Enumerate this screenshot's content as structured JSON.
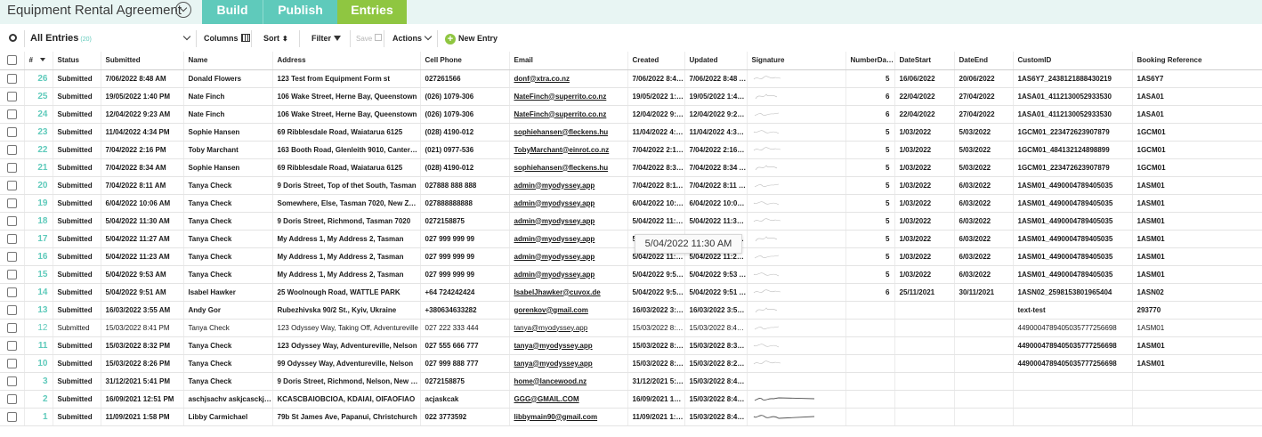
{
  "header": {
    "form_title": "Equipment Rental Agreement",
    "tabs": [
      {
        "label": "Build"
      },
      {
        "label": "Publish"
      },
      {
        "label": "Entries"
      }
    ]
  },
  "toolbar": {
    "view_label": "All Entries",
    "view_count": "(20)",
    "columns_label": "Columns",
    "sort_label": "Sort",
    "filter_label": "Filter",
    "save_label": "Save",
    "actions_label": "Actions",
    "new_entry_label": "New Entry"
  },
  "table": {
    "columns": [
      "#",
      "Status",
      "Submitted",
      "Name",
      "Address",
      "Cell Phone",
      "Email",
      "Created",
      "Updated",
      "Signature",
      "NumberDays",
      "DateStart",
      "DateEnd",
      "CustomID",
      "Booking Reference"
    ],
    "rows": [
      {
        "num": "26",
        "status": "Submitted",
        "submitted": "7/06/2022 8:48 AM",
        "name": "Donald Flowers",
        "address": "123 Test from Equipment Form st",
        "phone": "027261566",
        "email": "donf@xtra.co.nz",
        "created": "7/06/2022 8:48 AM",
        "updated": "7/06/2022 8:48 AM",
        "days": "5",
        "start": "16/06/2022",
        "end": "20/06/2022",
        "custom": "1AS6Y7_2438121888430219",
        "booking": "1AS6Y7",
        "read": true
      },
      {
        "num": "25",
        "status": "Submitted",
        "submitted": "19/05/2022 1:40 PM",
        "name": "Nate Finch",
        "address": "106 Wake Street, Herne Bay, Queenstown",
        "phone": "(026) 1079-306",
        "email": "NateFinch@superrito.co.nz",
        "created": "19/05/2022 1:40 PM",
        "updated": "19/05/2022 1:40 PM",
        "days": "6",
        "start": "22/04/2022",
        "end": "27/04/2022",
        "custom": "1ASA01_4112130052933530",
        "booking": "1ASA01",
        "read": true
      },
      {
        "num": "24",
        "status": "Submitted",
        "submitted": "12/04/2022 9:23 AM",
        "name": "Nate Finch",
        "address": "106 Wake Street, Herne Bay, Queenstown",
        "phone": "(026) 1079-306",
        "email": "NateFinch@superrito.co.nz",
        "created": "12/04/2022 9:23 AM",
        "updated": "12/04/2022 9:23 AM",
        "days": "6",
        "start": "22/04/2022",
        "end": "27/04/2022",
        "custom": "1ASA01_4112130052933530",
        "booking": "1ASA01",
        "read": true
      },
      {
        "num": "23",
        "status": "Submitted",
        "submitted": "11/04/2022 4:34 PM",
        "name": "Sophie Hansen",
        "address": "69 Ribblesdale Road, Waiatarua 6125",
        "phone": "(028) 4190-012",
        "email": "sophiehansen@fleckens.hu",
        "created": "11/04/2022 4:34 PM",
        "updated": "11/04/2022 4:34 PM",
        "days": "5",
        "start": "1/03/2022",
        "end": "5/03/2022",
        "custom": "1GCM01_223472623907879",
        "booking": "1GCM01",
        "read": true
      },
      {
        "num": "22",
        "status": "Submitted",
        "submitted": "7/04/2022 2:16 PM",
        "name": "Toby Marchant",
        "address": "163 Booth Road, Glenleith 9010, Canterbury",
        "phone": "(021) 0977-536",
        "email": "TobyMarchant@einrot.co.nz",
        "created": "7/04/2022 2:16 PM",
        "updated": "7/04/2022 2:16 PM",
        "days": "5",
        "start": "1/03/2022",
        "end": "5/03/2022",
        "custom": "1GCM01_484132124898899",
        "booking": "1GCM01",
        "read": true
      },
      {
        "num": "21",
        "status": "Submitted",
        "submitted": "7/04/2022 8:34 AM",
        "name": "Sophie Hansen",
        "address": "69 Ribblesdale Road, Waiatarua 6125",
        "phone": "(028) 4190-012",
        "email": "sophiehansen@fleckens.hu",
        "created": "7/04/2022 8:34 AM",
        "updated": "7/04/2022 8:34 AM",
        "days": "5",
        "start": "1/03/2022",
        "end": "5/03/2022",
        "custom": "1GCM01_223472623907879",
        "booking": "1GCM01",
        "read": true
      },
      {
        "num": "20",
        "status": "Submitted",
        "submitted": "7/04/2022 8:11 AM",
        "name": "Tanya Check",
        "address": "9 Doris Street, Top of thet South, Tasman",
        "phone": "027888 888 888",
        "email": "admin@myodyssey.app",
        "created": "7/04/2022 8:11 AM",
        "updated": "7/04/2022 8:11 AM",
        "days": "5",
        "start": "1/03/2022",
        "end": "6/03/2022",
        "custom": "1ASM01_4490004789405035",
        "booking": "1ASM01",
        "read": true
      },
      {
        "num": "19",
        "status": "Submitted",
        "submitted": "6/04/2022 10:06 AM",
        "name": "Tanya Check",
        "address": "Somewhere, Else, Tasman 7020, New Zealand",
        "phone": "027888888888",
        "email": "admin@myodyssey.app",
        "created": "6/04/2022 10:06 AM",
        "updated": "6/04/2022 10:06 AM",
        "days": "5",
        "start": "1/03/2022",
        "end": "6/03/2022",
        "custom": "1ASM01_4490004789405035",
        "booking": "1ASM01",
        "read": true
      },
      {
        "num": "18",
        "status": "Submitted",
        "submitted": "5/04/2022 11:30 AM",
        "name": "Tanya Check",
        "address": "9 Doris Street, Richmond, Tasman 7020",
        "phone": "0272158875",
        "email": "admin@myodyssey.app",
        "created": "5/04/2022 11:30 AM",
        "updated": "5/04/2022 11:30 AM",
        "days": "5",
        "start": "1/03/2022",
        "end": "6/03/2022",
        "custom": "1ASM01_4490004789405035",
        "booking": "1ASM01",
        "read": true
      },
      {
        "num": "17",
        "status": "Submitted",
        "submitted": "5/04/2022 11:27 AM",
        "name": "Tanya Check",
        "address": "My Address 1, My Address 2, Tasman",
        "phone": "027 999 999 99",
        "email": "admin@myodyssey.app",
        "created": "5/04/2022 11:27 AM",
        "updated": "5/04/2022 11:27 AM",
        "days": "5",
        "start": "1/03/2022",
        "end": "6/03/2022",
        "custom": "1ASM01_4490004789405035",
        "booking": "1ASM01",
        "read": true
      },
      {
        "num": "16",
        "status": "Submitted",
        "submitted": "5/04/2022 11:23 AM",
        "name": "Tanya Check",
        "address": "My Address 1, My Address 2, Tasman",
        "phone": "027 999 999 99",
        "email": "admin@myodyssey.app",
        "created": "5/04/2022 11:23 AM",
        "updated": "5/04/2022 11:23 AM",
        "days": "5",
        "start": "1/03/2022",
        "end": "6/03/2022",
        "custom": "1ASM01_4490004789405035",
        "booking": "1ASM01",
        "read": true
      },
      {
        "num": "15",
        "status": "Submitted",
        "submitted": "5/04/2022 9:53 AM",
        "name": "Tanya Check",
        "address": "My Address 1, My Address 2, Tasman",
        "phone": "027 999 999 99",
        "email": "admin@myodyssey.app",
        "created": "5/04/2022 9:53 AM",
        "updated": "5/04/2022 9:53 AM",
        "days": "5",
        "start": "1/03/2022",
        "end": "6/03/2022",
        "custom": "1ASM01_4490004789405035",
        "booking": "1ASM01",
        "read": true
      },
      {
        "num": "14",
        "status": "Submitted",
        "submitted": "5/04/2022 9:51 AM",
        "name": "Isabel Hawker",
        "address": "25 Woolnough Road, WATTLE PARK",
        "phone": "+64 724242424",
        "email": "IsabelJhawker@cuvox.de",
        "created": "5/04/2022 9:51 AM",
        "updated": "5/04/2022 9:51 AM",
        "days": "6",
        "start": "25/11/2021",
        "end": "30/11/2021",
        "custom": "1ASN02_2598153801965404",
        "booking": "1ASN02",
        "read": true
      },
      {
        "num": "13",
        "status": "Submitted",
        "submitted": "16/03/2022 3:55 AM",
        "name": "Andy Gor",
        "address": "Rubezhivska 90/2 St., Kyiv, Ukraine",
        "phone": "+380634633282",
        "email": "gorenkov@gmail.com",
        "created": "16/03/2022 3:55 AM",
        "updated": "16/03/2022 3:55 AM",
        "days": "",
        "start": "",
        "end": "",
        "custom": "text-test",
        "booking": "293770",
        "read": true
      },
      {
        "num": "12",
        "status": "Submitted",
        "submitted": "15/03/2022 8:41 PM",
        "name": "Tanya Check",
        "address": "123 Odyssey Way, Taking Off, Adventureville",
        "phone": "027 222 333 444",
        "email": "tanya@myodyssey.app",
        "created": "15/03/2022 8:41 PM",
        "updated": "15/03/2022 8:41 PM",
        "days": "",
        "start": "",
        "end": "",
        "custom": "4490004789405035777256698",
        "booking": "1ASM01",
        "read": false
      },
      {
        "num": "11",
        "status": "Submitted",
        "submitted": "15/03/2022 8:32 PM",
        "name": "Tanya Check",
        "address": "123 Odyssey Way, Adventureville, Nelson",
        "phone": "027 555 666 777",
        "email": "tanya@myodyssey.app",
        "created": "15/03/2022 8:32 PM",
        "updated": "15/03/2022 8:32 PM",
        "days": "",
        "start": "",
        "end": "",
        "custom": "4490004789405035777256698",
        "booking": "1ASM01",
        "read": true
      },
      {
        "num": "10",
        "status": "Submitted",
        "submitted": "15/03/2022 8:26 PM",
        "name": "Tanya Check",
        "address": "99 Odyssey Way, Adventureville, Nelson",
        "phone": "027 999 888 777",
        "email": "tanya@myodyssey.app",
        "created": "15/03/2022 8:26 PM",
        "updated": "15/03/2022 8:26 PM",
        "days": "",
        "start": "",
        "end": "",
        "custom": "4490004789405035777256698",
        "booking": "1ASM01",
        "read": true
      },
      {
        "num": "3",
        "status": "Submitted",
        "submitted": "31/12/2021 5:41 PM",
        "name": "Tanya Check",
        "address": "9 Doris Street, Richmond, Nelson, New Zealand",
        "phone": "0272158875",
        "email": "home@lancewood.nz",
        "created": "31/12/2021 5:41 PM",
        "updated": "15/03/2022 8:41 PM",
        "days": "",
        "start": "",
        "end": "",
        "custom": "",
        "booking": "",
        "read": true
      },
      {
        "num": "2",
        "status": "Submitted",
        "submitted": "16/09/2021 12:51 PM",
        "name": "aschjsachv askjcasckjsa",
        "address": "KCASCBAIOBCIOA, KDAIAI, OIFAOFIAO",
        "phone": "acjaskcak",
        "email": "GGG@GMAIL.COM",
        "created": "16/09/2021 12:51 PM",
        "updated": "15/03/2022 8:41 PM",
        "days": "",
        "start": "",
        "end": "",
        "custom": "",
        "booking": "",
        "read": true
      },
      {
        "num": "1",
        "status": "Submitted",
        "submitted": "11/09/2021 1:58 PM",
        "name": "Libby Carmichael",
        "address": "79b St James Ave, Papanui, Christchurch",
        "phone": "022 3773592",
        "email": "libbymain90@gmail.com",
        "created": "11/09/2021 1:58 PM",
        "updated": "15/03/2022 8:41 PM",
        "days": "",
        "start": "",
        "end": "",
        "custom": "",
        "booking": "",
        "read": true
      }
    ]
  },
  "tooltip": {
    "text": "5/04/2022 11:30 AM"
  }
}
